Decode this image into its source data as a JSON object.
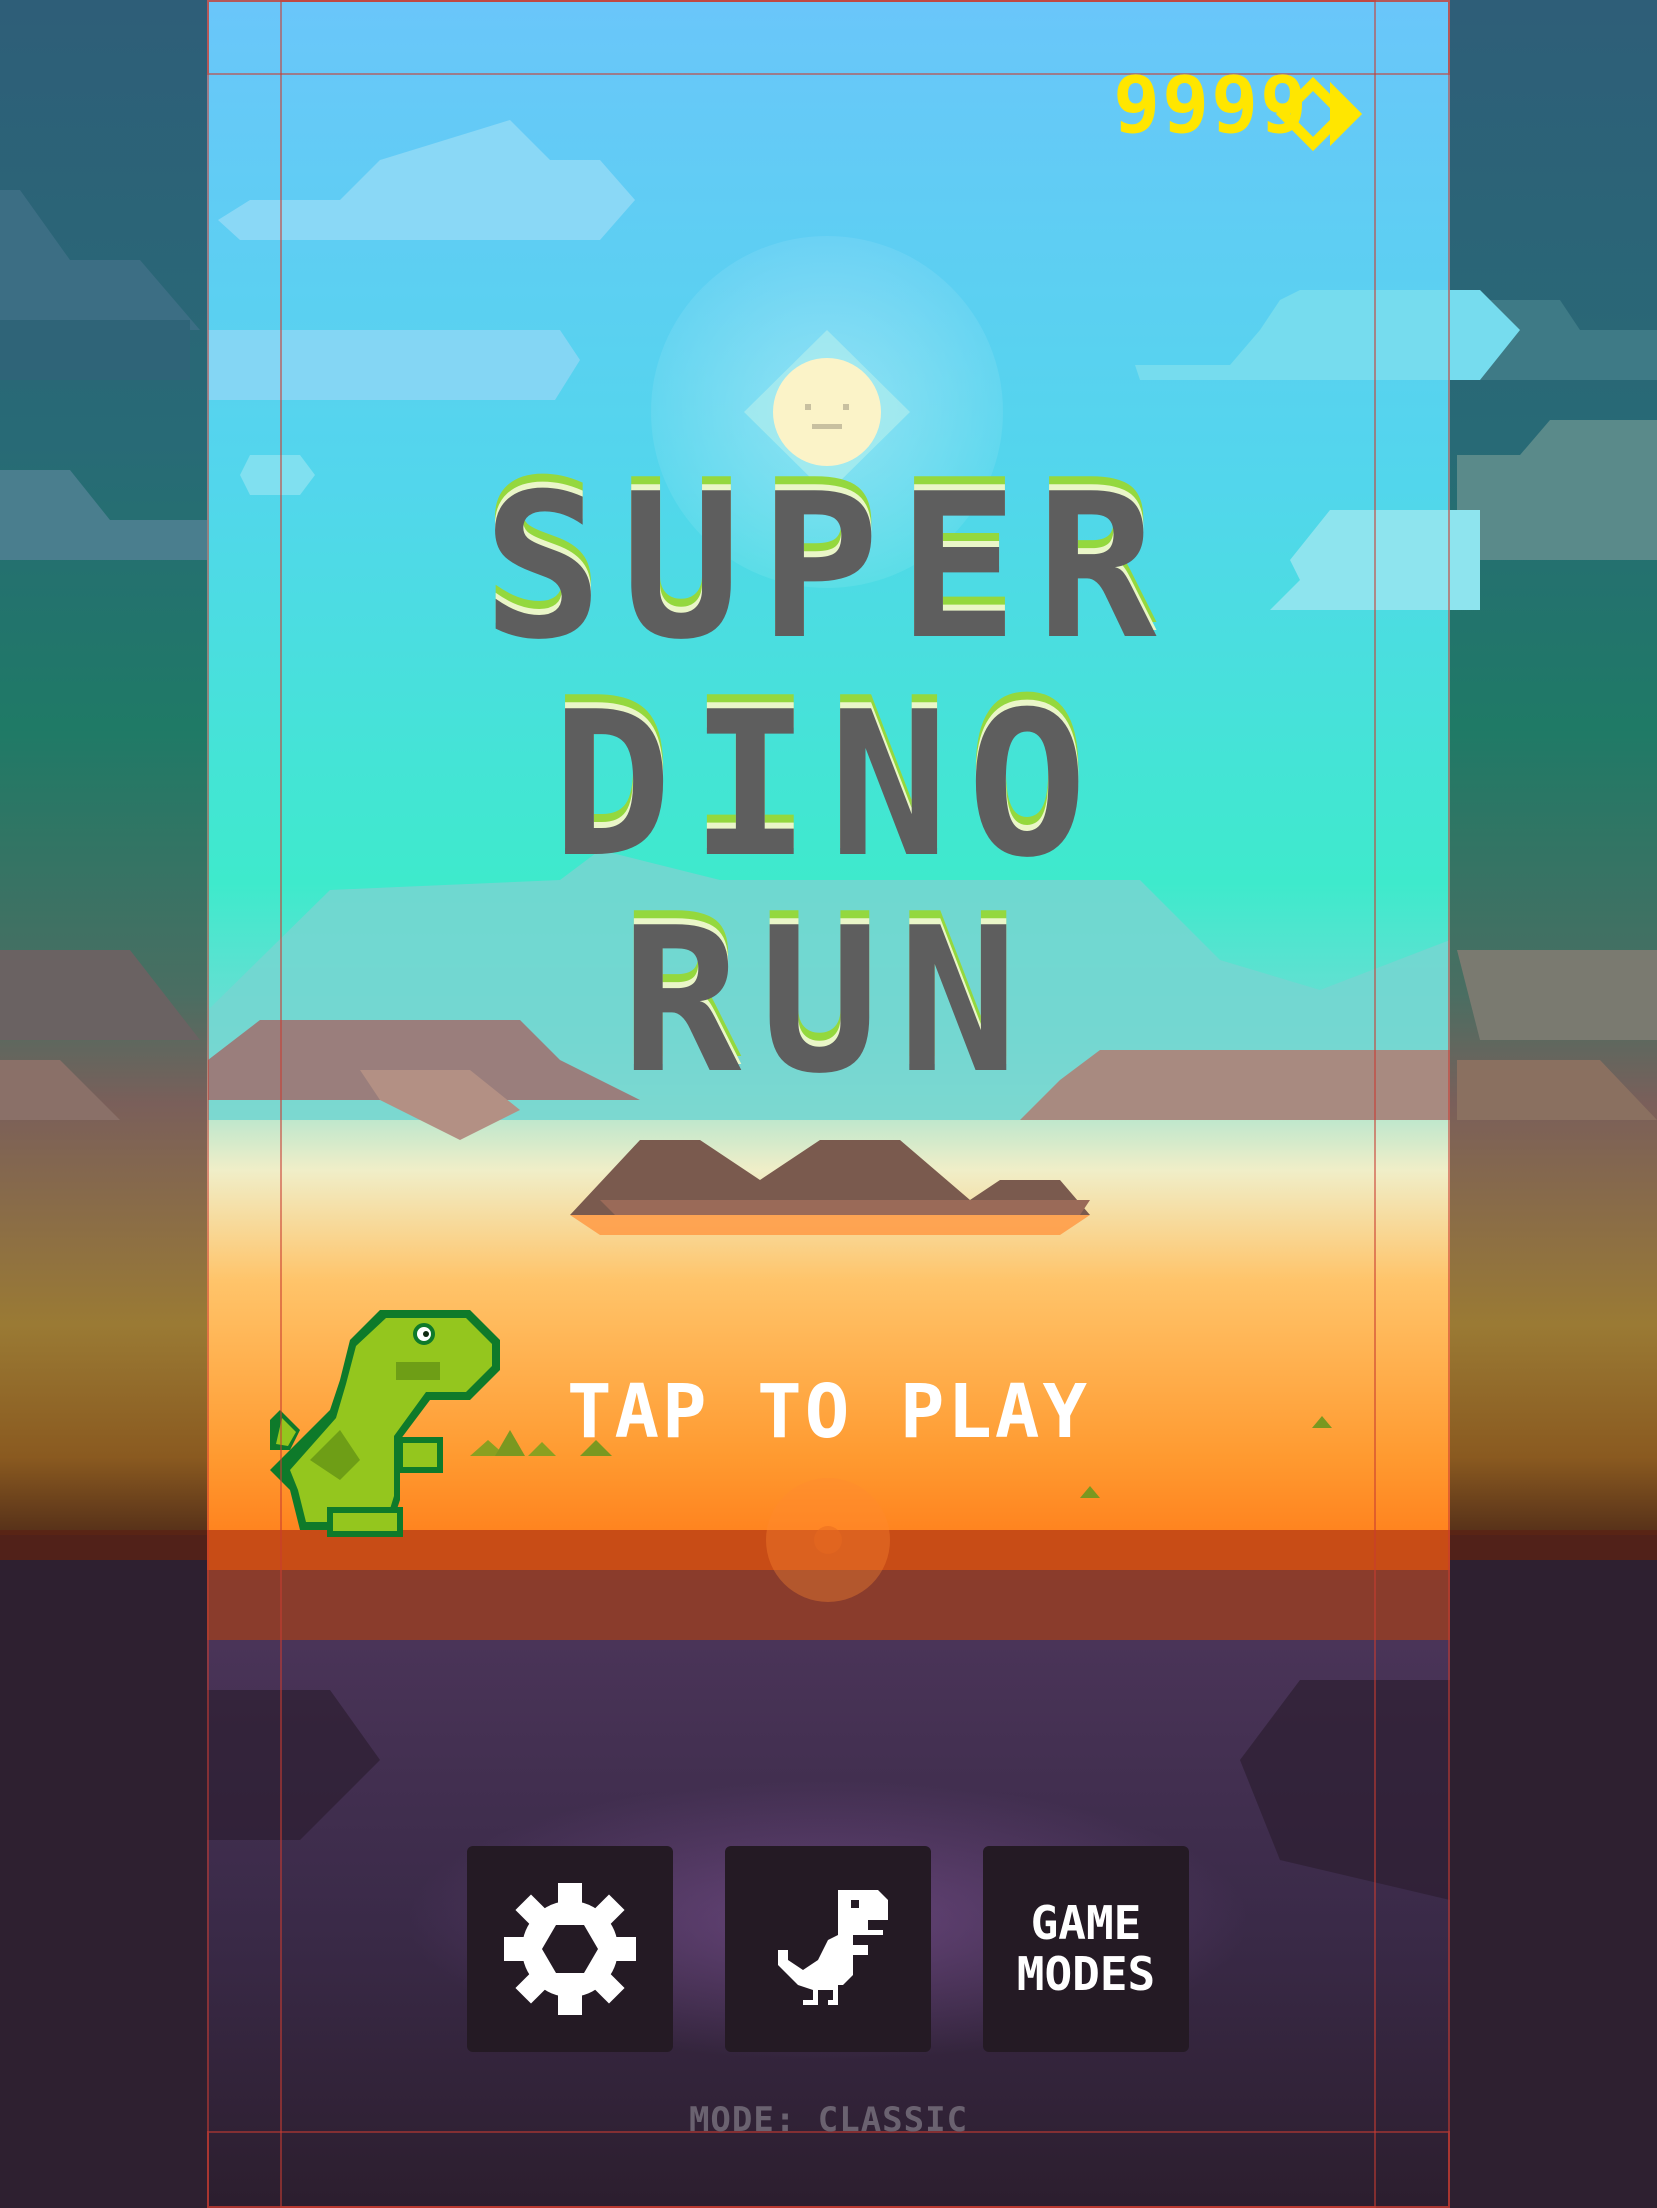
{
  "game": {
    "title_lines": [
      "SUPER",
      "DINO",
      "RUN"
    ],
    "score": "9999",
    "currency_icon": "diamond-chevron-icon",
    "prompt": "TAP TO PLAY",
    "mode_status": "MODE: CLASSIC"
  },
  "menu": {
    "settings_icon": "gear-icon",
    "character_icon": "dino-icon",
    "game_modes_label": "GAME\nMODES"
  },
  "colors": {
    "sky_top": "#66c8f8",
    "sky_mid": "#3ee8cc",
    "horizon_orange": "#ff7a14",
    "ground_purple": "#3e2c50",
    "title_gray": "#5e5e5e",
    "score_yellow": "#ffe600",
    "button_bg": "#241a24",
    "dino_green": "#8cc21e"
  }
}
